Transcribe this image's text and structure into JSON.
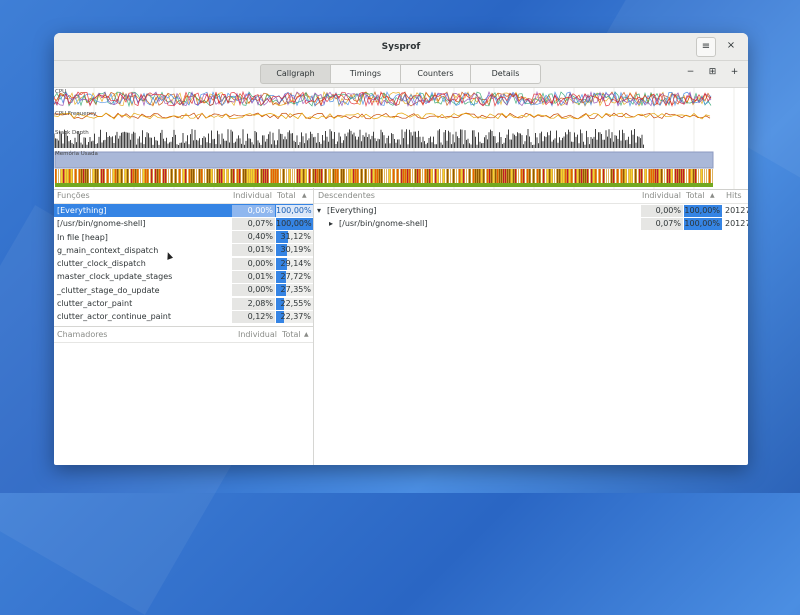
{
  "window": {
    "title": "Sysprof"
  },
  "toolbar": {
    "tabs": [
      {
        "label": "Callgraph",
        "active": true
      },
      {
        "label": "Timings",
        "active": false
      },
      {
        "label": "Counters",
        "active": false
      },
      {
        "label": "Details",
        "active": false
      }
    ],
    "menu_icon": "≡",
    "close_icon": "×",
    "zoom_out_icon": "−",
    "zoom_fit_icon": "⊞",
    "zoom_in_icon": "+"
  },
  "tracks": {
    "cpu_label": "CPU",
    "cpu_freq_label": "CPU Frequency",
    "stack_label": "Stack Depth",
    "memory_label": "Memória Usada"
  },
  "functions": {
    "header": {
      "name": "Funções",
      "individual": "Individual",
      "total": "Total"
    },
    "rows": [
      {
        "name": "[Everything]",
        "individual": "0,00%",
        "total": "100,00%",
        "total_value": 100,
        "selected": true
      },
      {
        "name": "[/usr/bin/gnome-shell]",
        "individual": "0,07%",
        "total": "100,00%",
        "total_value": 100
      },
      {
        "name": "In file [heap]",
        "individual": "0,40%",
        "total": "31,12%",
        "total_value": 31.12
      },
      {
        "name": "g_main_context_dispatch",
        "individual": "0,01%",
        "total": "30,19%",
        "total_value": 30.19
      },
      {
        "name": "clutter_clock_dispatch",
        "individual": "0,00%",
        "total": "29,14%",
        "total_value": 29.14
      },
      {
        "name": "master_clock_update_stages",
        "individual": "0,01%",
        "total": "27,72%",
        "total_value": 27.72
      },
      {
        "name": "_clutter_stage_do_update",
        "individual": "0,00%",
        "total": "27,35%",
        "total_value": 27.35
      },
      {
        "name": "clutter_actor_paint",
        "individual": "2,08%",
        "total": "22,55%",
        "total_value": 22.55
      },
      {
        "name": "clutter_actor_continue_paint",
        "individual": "0,12%",
        "total": "22,37%",
        "total_value": 22.37
      }
    ]
  },
  "callers": {
    "header": {
      "name": "Chamadores",
      "individual": "Individual",
      "total": "Total"
    }
  },
  "descendants": {
    "header": {
      "name": "Descendentes",
      "individual": "Individual",
      "total": "Total",
      "hits": "Hits"
    },
    "rows": [
      {
        "name": "[Everything]",
        "expander": "▾",
        "individual": "0,00%",
        "total": "100,00%",
        "total_value": 100,
        "hits": "20127"
      },
      {
        "name": "[/usr/bin/gnome-shell]",
        "expander": "▸",
        "individual": "0,07%",
        "total": "100,00%",
        "total_value": 100,
        "hits": "20127"
      }
    ]
  },
  "colors": {
    "accent": "#3584e4",
    "memory": "#aab8d8"
  }
}
